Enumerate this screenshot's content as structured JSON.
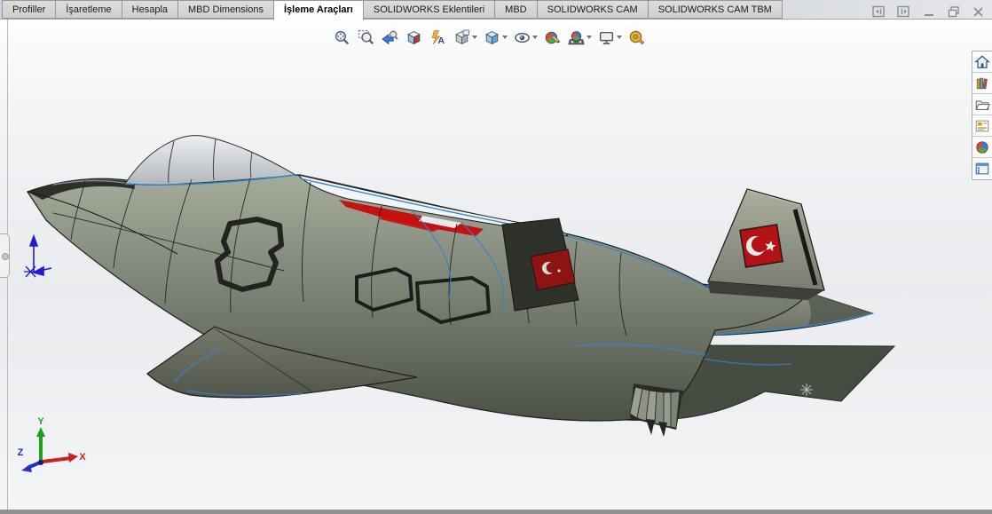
{
  "tab_bar": {
    "tabs": [
      {
        "label": "Profiller",
        "active": false
      },
      {
        "label": "İşaretleme",
        "active": false
      },
      {
        "label": "Hesapla",
        "active": false
      },
      {
        "label": "MBD Dimensions",
        "active": false
      },
      {
        "label": "İşleme Araçları",
        "active": true
      },
      {
        "label": "SOLIDWORKS Eklentileri",
        "active": false
      },
      {
        "label": "MBD",
        "active": false
      },
      {
        "label": "SOLIDWORKS CAM",
        "active": false
      },
      {
        "label": "SOLIDWORKS CAM TBM",
        "active": false
      }
    ]
  },
  "window_controls": {
    "items": [
      {
        "name": "collapse-left"
      },
      {
        "name": "collapse-right"
      },
      {
        "name": "minimize"
      },
      {
        "name": "restore"
      },
      {
        "name": "close"
      }
    ]
  },
  "hud_toolbar": {
    "items": [
      {
        "name": "zoom-to-fit",
        "dropdown": false
      },
      {
        "name": "zoom-to-area",
        "dropdown": false
      },
      {
        "name": "previous-view",
        "dropdown": false
      },
      {
        "name": "section-view",
        "dropdown": false
      },
      {
        "name": "dynamic-annotation-views",
        "dropdown": false
      },
      {
        "name": "view-orientation",
        "dropdown": true
      },
      {
        "name": "display-style",
        "dropdown": true
      },
      {
        "name": "hide-show-items",
        "dropdown": true
      },
      {
        "name": "edit-appearance",
        "dropdown": false
      },
      {
        "name": "apply-scene",
        "dropdown": true
      },
      {
        "name": "view-settings",
        "dropdown": true
      },
      {
        "name": "measure",
        "dropdown": false
      }
    ]
  },
  "task_pane": {
    "items": [
      {
        "name": "solidworks-resources"
      },
      {
        "name": "design-library"
      },
      {
        "name": "file-explorer"
      },
      {
        "name": "view-palette"
      },
      {
        "name": "appearances-scenes-decals"
      },
      {
        "name": "custom-properties"
      }
    ]
  },
  "viewport": {
    "model": {
      "description": "fighter-jet-3d-model-with-turkish-flag-tail"
    },
    "triad": {
      "x_label": "X",
      "y_label": "Y",
      "z_label": "Z"
    },
    "colors": {
      "edge_highlight": "#2e86d4",
      "flag_red": "#b31217",
      "body_gray_green": "#7e8476",
      "canopy_gray": "#d9dbde",
      "spine_white": "#f3f4f5",
      "marking_red": "#c51111"
    }
  }
}
